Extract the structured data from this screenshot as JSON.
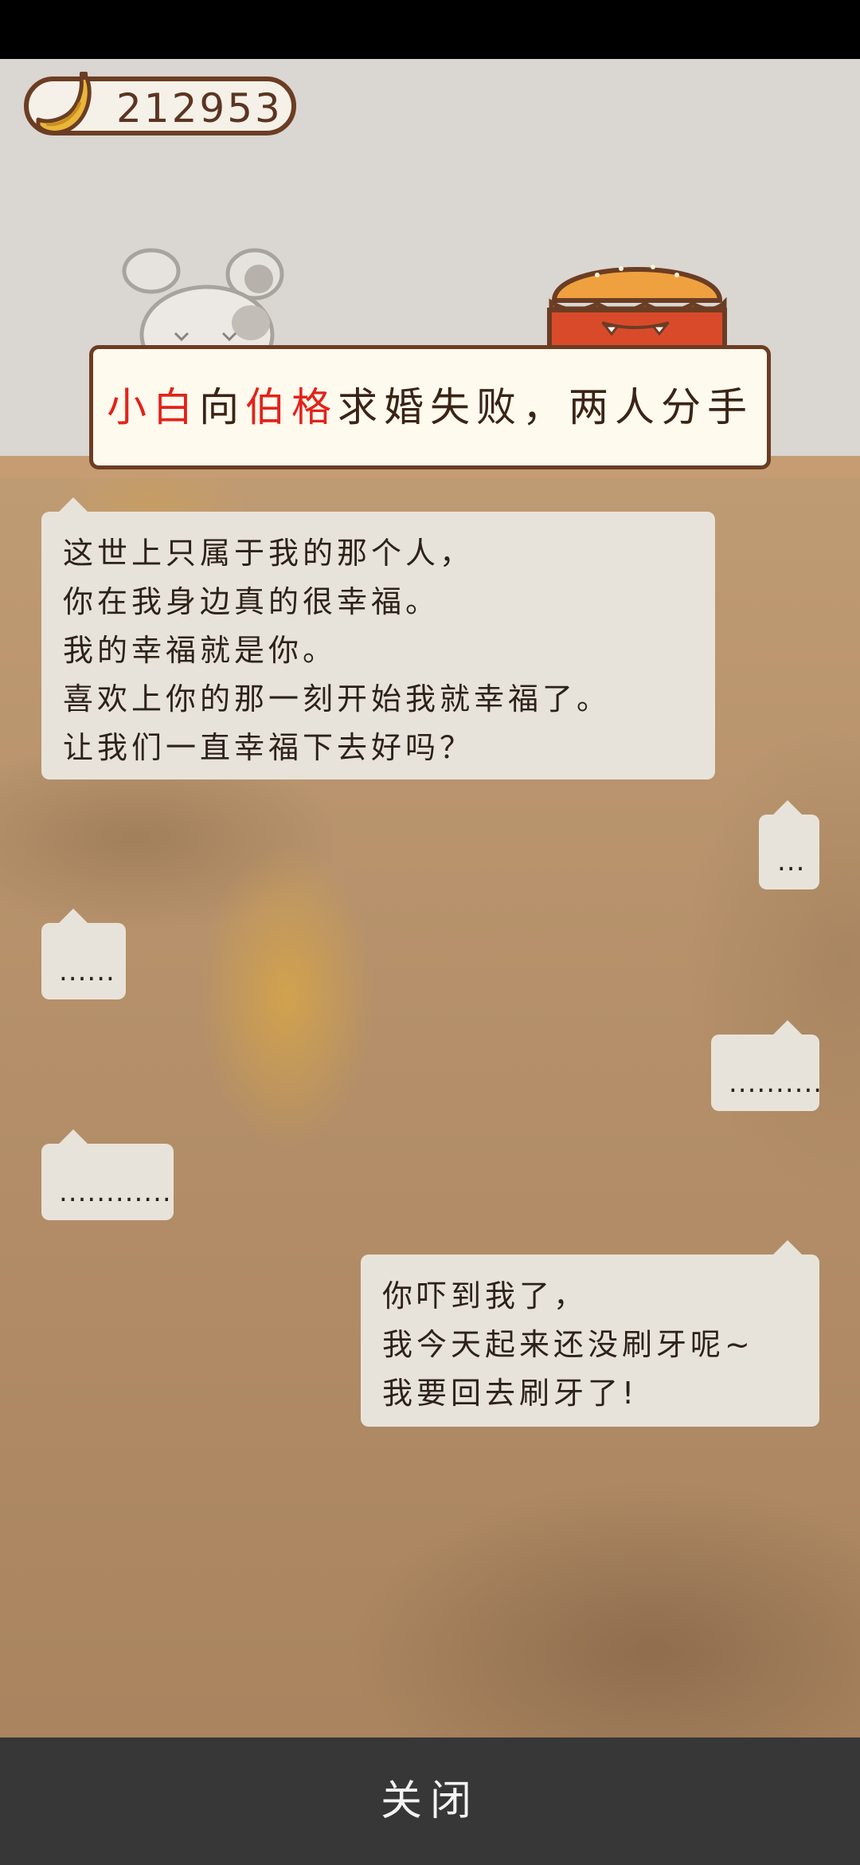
{
  "currency": {
    "icon": "banana-icon",
    "amount": "212953"
  },
  "characters": {
    "left": "rabbit-character",
    "right": "burger-character"
  },
  "event": {
    "name1": "小白",
    "verb": "向",
    "name2": "伯格",
    "rest": "求婚失败，两人分手",
    "highlight_color": "#e2231a"
  },
  "dialogue": [
    {
      "side": "left",
      "lines": [
        "这世上只属于我的那个人，",
        "你在我身边真的很幸福。",
        "我的幸福就是你。",
        "喜欢上你的那一刻开始我就幸福了。",
        "让我们一直幸福下去好吗？"
      ]
    },
    {
      "side": "right",
      "lines": [
        "..."
      ]
    },
    {
      "side": "left",
      "lines": [
        "......"
      ]
    },
    {
      "side": "right",
      "lines": [
        ".........."
      ]
    },
    {
      "side": "left",
      "lines": [
        "............"
      ]
    },
    {
      "side": "right",
      "lines": [
        "你吓到我了，",
        "我今天起来还没刷牙呢~",
        "我要回去刷牙了!"
      ]
    }
  ],
  "close_button": "关闭"
}
